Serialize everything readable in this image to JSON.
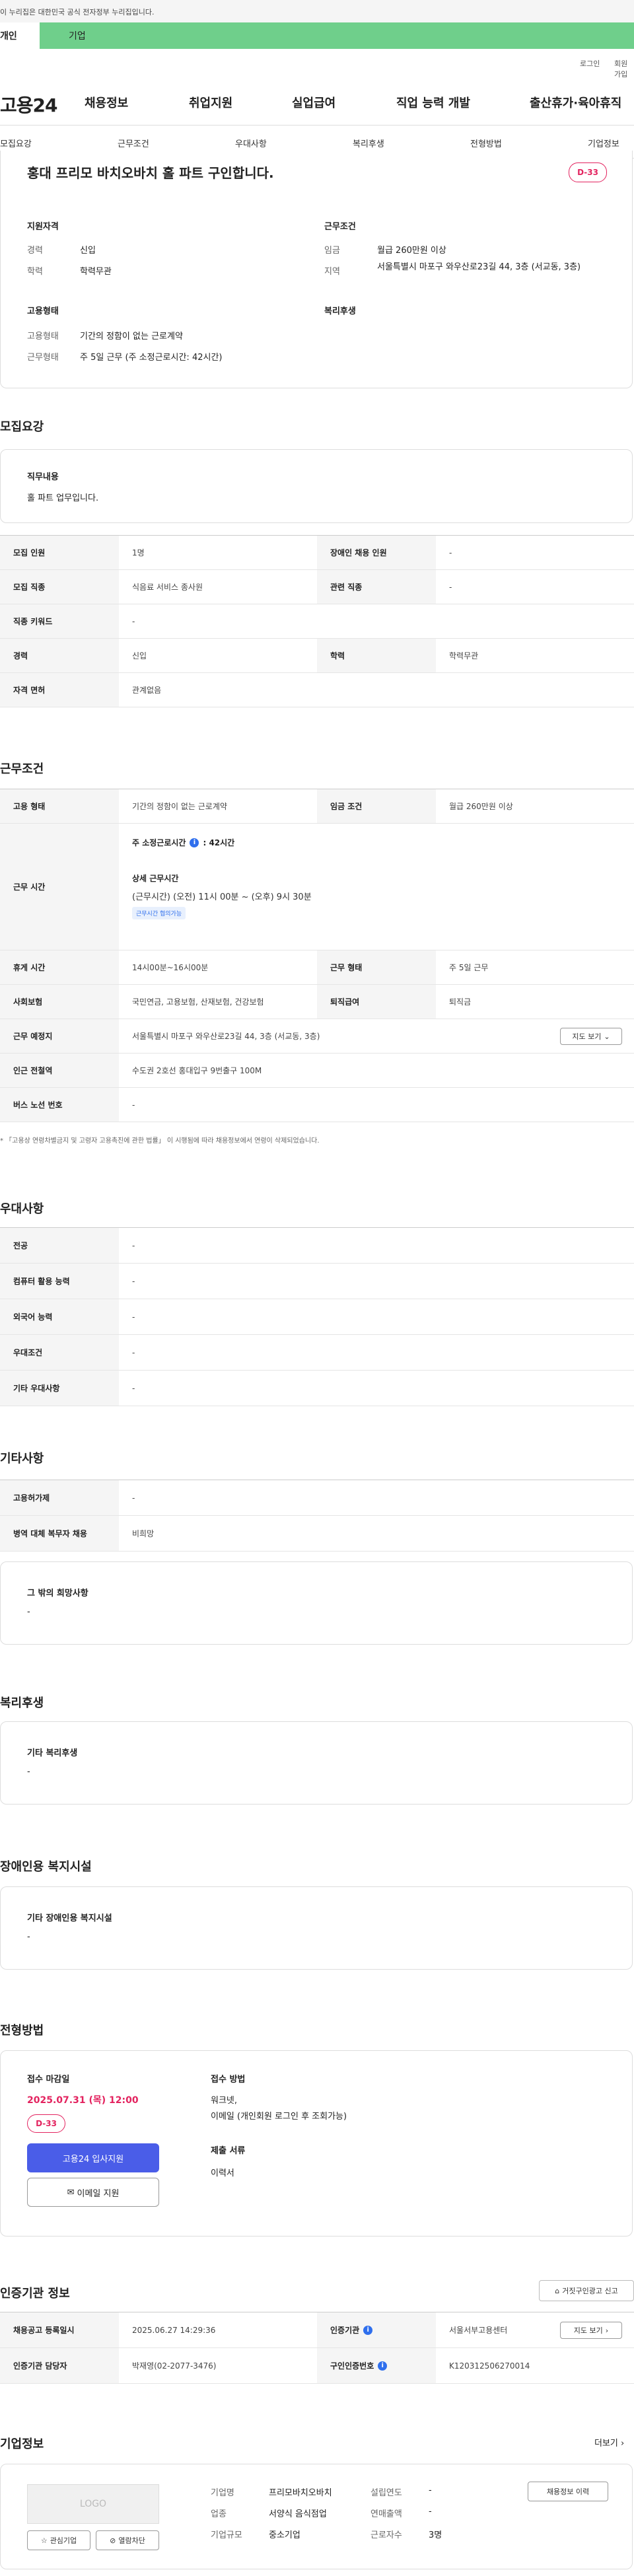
{
  "gov_banner": "이 누리집은 대한민국 공식 전자정부 누리집입니다.",
  "top_tabs": [
    "개인",
    "기업"
  ],
  "util": {
    "login": "로그인",
    "join": "회원가입"
  },
  "site_logo": "고용24",
  "gnb": [
    "채용정보",
    "취업지원",
    "실업급여",
    "직업 능력 개발",
    "출산휴가·육아휴직"
  ],
  "snb": [
    "모집요강",
    "근무조건",
    "우대사항",
    "복리후생",
    "전형방법",
    "기업정보"
  ],
  "job": {
    "title": "홍대 프리모 바치오바치 홀 파트 구인합니다.",
    "dday": "D-33",
    "qual_title": "지원자격",
    "career_label": "경력",
    "career": "신입",
    "edu_label": "학력",
    "edu": "학력무관",
    "cond_title": "근무조건",
    "wage_label": "임금",
    "wage": "월급 260만원 이상",
    "region_label": "지역",
    "region": "서울특별시 마포구 와우산로23길 44, 3층 (서교동, 3층)",
    "emp_title": "고용형태",
    "emp_label": "고용형태",
    "emp": "기간의 정함이 없는 근로계약",
    "work_label": "근무형태",
    "work": "주 5일 근무 (주 소정근로시간: 42시간)",
    "welfare_title": "복리후생"
  },
  "recruit": {
    "section": "모집요강",
    "duty_label": "직무내용",
    "duty": "홀 파트 업무입니다.",
    "rows": [
      {
        "k1": "모집 인원",
        "v1": "1명",
        "k2": "장애인 채용 인원",
        "v2": "-"
      },
      {
        "k1": "모집 직종",
        "v1": "식음료 서비스 종사원",
        "k2": "관련 직종",
        "v2": "-"
      },
      {
        "k1": "직종 키워드",
        "v1": "-"
      },
      {
        "k1": "경력",
        "v1": "신입",
        "k2": "학력",
        "v2": "학력무관"
      },
      {
        "k1": "자격 면허",
        "v1": "관계없음"
      }
    ]
  },
  "work": {
    "section": "근무조건",
    "emp_type_label": "고용 형태",
    "emp_type": "기간의 정함이 없는 근로계약",
    "wage_cond_label": "임금 조건",
    "wage_cond": "월급 260만원 이상",
    "hours_label": "근무 시간",
    "hours_weekly_label": "주 소정근로시간",
    "hours_weekly": ": 42시간",
    "detail_label": "상세 근무시간",
    "detail": "(근무시간) (오전) 11시 00분 ~ (오후) 9시 30분",
    "consult_tag": "근무시간 협의가능",
    "rest_label": "휴게 시간",
    "rest": "14시00분~16시00분",
    "work_form_label": "근무 형태",
    "work_form": "주 5일 근무",
    "insurance_label": "사회보험",
    "insurance": "국민연금, 고용보험, 산재보험, 건강보험",
    "retire_label": "퇴직급여",
    "retire": "퇴직금",
    "place_label": "근무 예정지",
    "place": "서울특별시 마포구 와우산로23길 44, 3층 (서교동, 3층)",
    "map_btn": "지도 보기",
    "subway_label": "인근 전철역",
    "subway": "수도권 2호선 홍대입구 9번출구 100M",
    "bus_label": "버스 노선 번호",
    "bus": "-",
    "notice": "* 「고용상 연령차별금지 및 고령자 고용촉진에 관한 법률」 이 시행됨에 따라 채용정보에서 연령이 삭제되었습니다."
  },
  "pref": {
    "section": "우대사항",
    "rows": [
      {
        "k": "전공",
        "v": "-"
      },
      {
        "k": "컴퓨터 활용 능력",
        "v": "-"
      },
      {
        "k": "외국어 능력",
        "v": "-"
      },
      {
        "k": "우대조건",
        "v": "-"
      },
      {
        "k": "기타 우대사항",
        "v": "-"
      }
    ]
  },
  "etc": {
    "section": "기타사항",
    "rows": [
      {
        "k": "고용허가제",
        "v": "-"
      },
      {
        "k": "병역 대체 복무자 채용",
        "v": "비희망"
      }
    ],
    "other_label": "그 밖의 희망사항",
    "other": "-"
  },
  "welfare": {
    "section": "복리후생",
    "label": "기타 복리후생",
    "value": "-"
  },
  "disabled": {
    "section": "장애인용 복지시설",
    "label": "기타 장애인용 복지시설",
    "value": "-"
  },
  "apply": {
    "section": "전형방법",
    "deadline_label": "접수 마감일",
    "deadline": "2025.07.31 (목) 12:00",
    "dday": "D-33",
    "apply_btn": "고용24 입사지원",
    "email_btn": "이메일 지원",
    "method_label": "접수 방법",
    "method1": "워크넷,",
    "method2": "이메일 (개인회원 로그인 후 조회가능)",
    "docs_label": "제출 서류",
    "docs": "이력서"
  },
  "cert": {
    "section": "인증기관 정보",
    "report_btn": "거짓구인광고 신고",
    "reg_label": "채용공고 등록일시",
    "reg": "2025.06.27 14:29:36",
    "org_label": "인증기관",
    "org": "서울서부고용센터",
    "map_btn": "지도 보기",
    "manager_label": "인증기관 담당자",
    "manager": "박재영(02-2077-3476)",
    "cert_no_label": "구인인증번호",
    "cert_no": "K120312506270014"
  },
  "company": {
    "section": "기업정보",
    "more": "더보기",
    "logo_text": "LOGO",
    "fav_btn": "관심기업",
    "block_btn": "열람차단",
    "name_label": "기업명",
    "name": "프리모바치오바치",
    "industry_label": "업종",
    "industry": "서양식 음식점업",
    "scale_label": "기업규모",
    "scale": "중소기업",
    "founded_label": "설립연도",
    "founded": "-",
    "revenue_label": "연매출액",
    "revenue": "-",
    "employees_label": "근로자수",
    "employees": "3명",
    "history_btn": "채용정보 이력"
  }
}
